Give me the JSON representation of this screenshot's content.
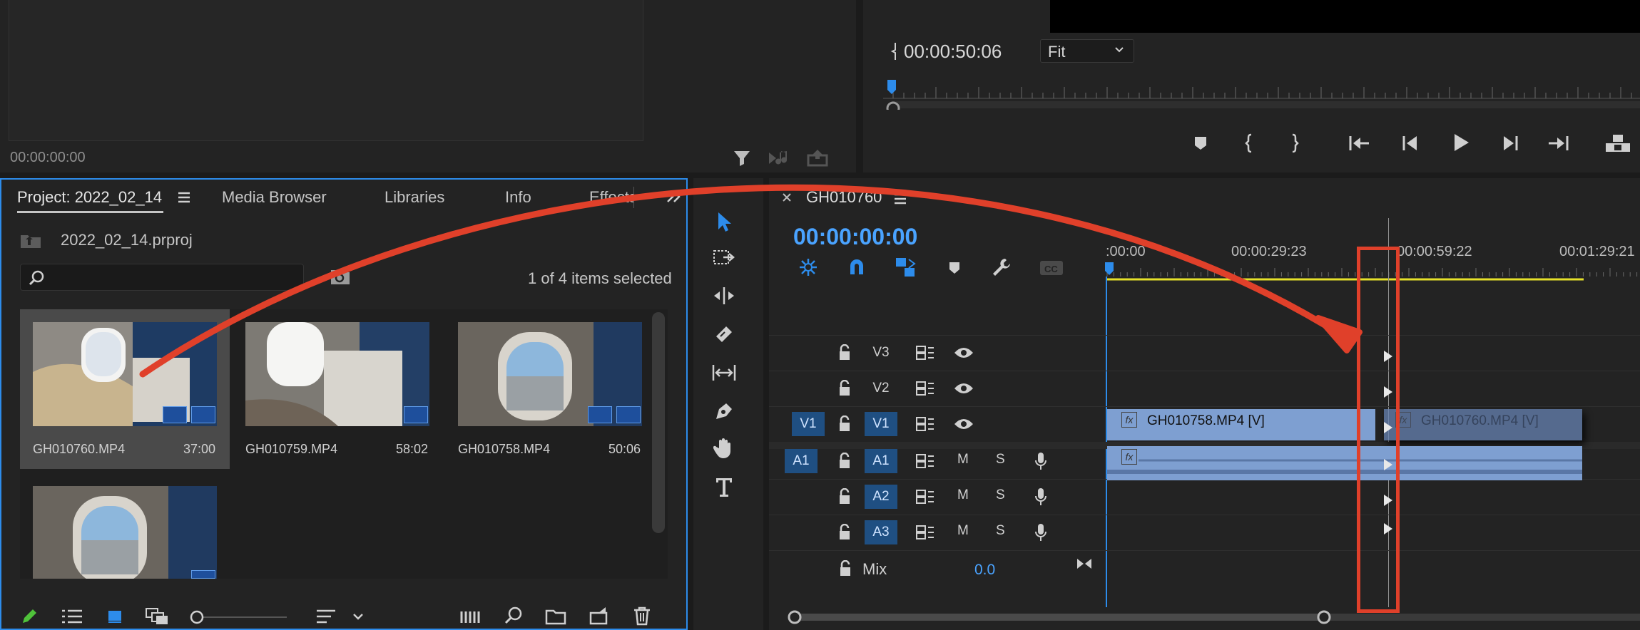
{
  "source_monitor": {
    "timecode": "00:00:00:00"
  },
  "program_monitor": {
    "timecode": "00:00:50:06",
    "zoom_select": "Fit"
  },
  "project_panel": {
    "tabs": [
      "Project: 2022_02_14",
      "Media Browser",
      "Libraries",
      "Info",
      "Effects"
    ],
    "project_file": "2022_02_14.prproj",
    "search_placeholder": "",
    "selection_status": "1 of 4 items selected",
    "clips": [
      {
        "name": "GH010760.MP4",
        "duration": "37:00"
      },
      {
        "name": "GH010759.MP4",
        "duration": "58:02"
      },
      {
        "name": "GH010758.MP4",
        "duration": "50:06"
      }
    ]
  },
  "timeline": {
    "sequence_name": "GH010760",
    "timecode": "00:00:00:00",
    "ruler_labels": [
      ":00:00",
      "00:00:29:23",
      "00:00:59:22",
      "00:01:29:21"
    ],
    "tracks": {
      "video": [
        {
          "source": "",
          "target": "V3"
        },
        {
          "source": "",
          "target": "V2"
        },
        {
          "source": "V1",
          "target": "V1"
        }
      ],
      "audio": [
        {
          "source": "A1",
          "target": "A1"
        },
        {
          "source": "",
          "target": "A2"
        },
        {
          "source": "",
          "target": "A3"
        }
      ],
      "mute_label": "M",
      "solo_label": "S"
    },
    "clips": {
      "v1_clip": "GH010758.MP4 [V]",
      "v1_dragged_clip": "GH010760.MP4 [V]",
      "fx_label": "fx"
    },
    "mix": {
      "label": "Mix",
      "value": "0.0"
    }
  },
  "colors": {
    "accent_blue": "#2d8ceb",
    "timecode_blue": "#4aa3ff",
    "annotation_red": "#e0402a",
    "clip_blue": "#7e9fd1",
    "work_area_yellow": "#e6e12a"
  }
}
